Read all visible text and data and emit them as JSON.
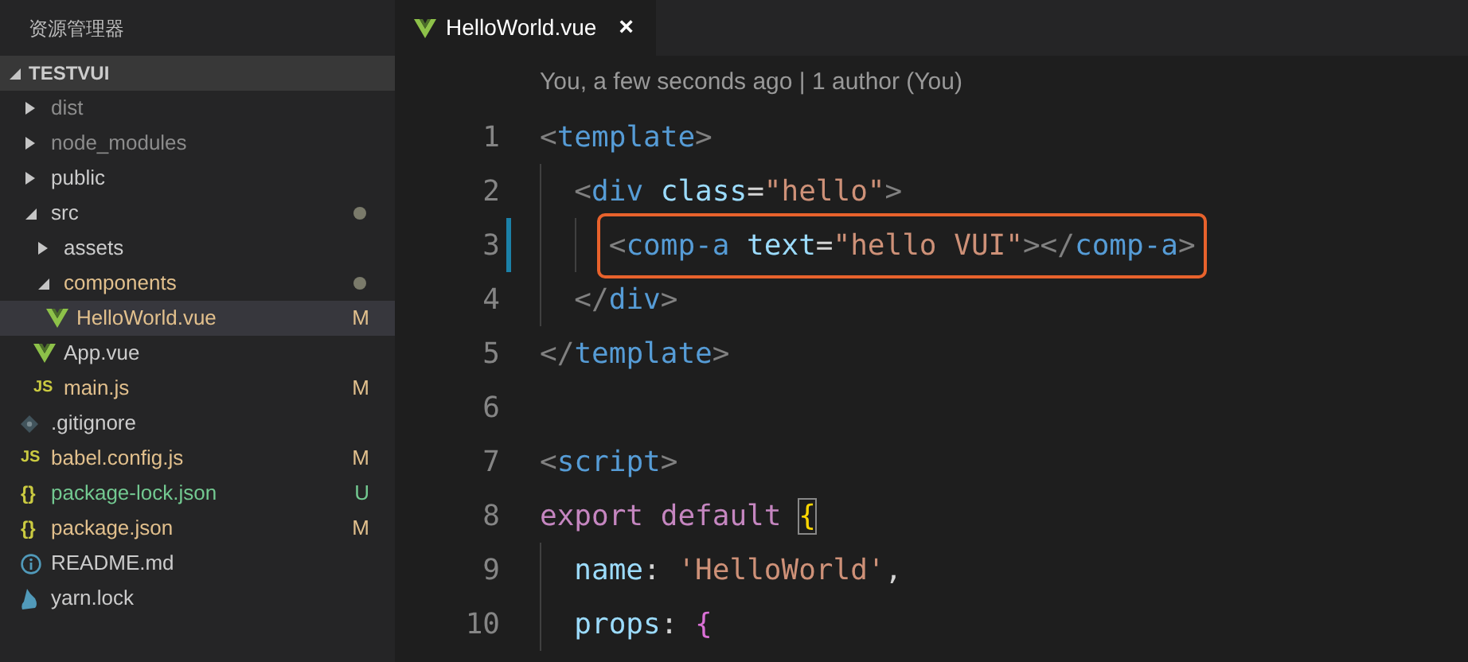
{
  "sidebar": {
    "title": "资源管理器",
    "root": {
      "name": "TESTVUI",
      "expanded": true,
      "children": [
        {
          "kind": "folder",
          "name": "dist",
          "expanded": false,
          "color": "#8c8c8c",
          "selected": false
        },
        {
          "kind": "folder",
          "name": "node_modules",
          "expanded": false,
          "color": "#8c8c8c",
          "selected": false
        },
        {
          "kind": "folder",
          "name": "public",
          "expanded": false,
          "color": "#cccccc",
          "selected": false
        },
        {
          "kind": "folder",
          "name": "src",
          "expanded": true,
          "color": "#cccccc",
          "has_changes": true,
          "selected": false,
          "children": [
            {
              "kind": "folder",
              "name": "assets",
              "expanded": false,
              "color": "#cccccc",
              "selected": false
            },
            {
              "kind": "folder",
              "name": "components",
              "expanded": true,
              "color": "#e2c08d",
              "has_changes": true,
              "selected": false,
              "children": [
                {
                  "kind": "vue",
                  "name": "HelloWorld.vue",
                  "color": "#e2c08d",
                  "badge": "M",
                  "selected": true
                }
              ]
            },
            {
              "kind": "vue",
              "name": "App.vue",
              "color": "#cccccc",
              "selected": false
            },
            {
              "kind": "js",
              "icon_text": "JS",
              "name": "main.js",
              "color": "#e2c08d",
              "badge": "M",
              "selected": false
            }
          ]
        },
        {
          "kind": "git",
          "name": ".gitignore",
          "color": "#cccccc",
          "selected": false
        },
        {
          "kind": "js",
          "icon_text": "JS",
          "name": "babel.config.js",
          "color": "#e2c08d",
          "badge": "M",
          "selected": false
        },
        {
          "kind": "json",
          "icon_text": "{}",
          "name": "package-lock.json",
          "color": "#73c991",
          "badge": "U",
          "selected": false
        },
        {
          "kind": "json",
          "icon_text": "{}",
          "name": "package.json",
          "color": "#e2c08d",
          "badge": "M",
          "selected": false
        },
        {
          "kind": "info",
          "name": "README.md",
          "color": "#cccccc",
          "selected": false
        },
        {
          "kind": "yarn",
          "name": "yarn.lock",
          "color": "#cccccc",
          "selected": false
        }
      ]
    }
  },
  "tabs": [
    {
      "kind": "vue",
      "label": "HelloWorld.vue",
      "close": "×",
      "selected": true
    }
  ],
  "codelens": "You, a few seconds ago | 1 author (You)",
  "lines": [
    {
      "number": "1",
      "tokens": [
        {
          "kind": "punct",
          "text": "<"
        },
        {
          "kind": "tag",
          "text": "template"
        },
        {
          "kind": "punct",
          "text": ">"
        }
      ]
    },
    {
      "number": "2",
      "tokens": [
        {
          "kind": "punct",
          "text": "  <"
        },
        {
          "kind": "tag",
          "text": "div"
        },
        {
          "kind": "attr",
          "text": " class"
        },
        {
          "kind": "op",
          "text": "="
        },
        {
          "kind": "string",
          "text": "\"hello\""
        },
        {
          "kind": "punct",
          "text": ">"
        }
      ]
    },
    {
      "number": "3",
      "changed": true,
      "boxed": true,
      "tokens": [
        {
          "kind": "punct",
          "text": "    <"
        },
        {
          "kind": "tag",
          "text": "comp-a"
        },
        {
          "kind": "attr",
          "text": " text"
        },
        {
          "kind": "op",
          "text": "="
        },
        {
          "kind": "string",
          "text": "\"hello VUI\""
        },
        {
          "kind": "punct",
          "text": "></"
        },
        {
          "kind": "tag",
          "text": "comp-a"
        },
        {
          "kind": "punct",
          "text": ">"
        }
      ]
    },
    {
      "number": "4",
      "tokens": [
        {
          "kind": "punct",
          "text": "  </"
        },
        {
          "kind": "tag",
          "text": "div"
        },
        {
          "kind": "punct",
          "text": ">"
        }
      ]
    },
    {
      "number": "5",
      "tokens": [
        {
          "kind": "punct",
          "text": "</"
        },
        {
          "kind": "tag",
          "text": "template"
        },
        {
          "kind": "punct",
          "text": ">"
        }
      ]
    },
    {
      "number": "6"
    },
    {
      "number": "7",
      "tokens": [
        {
          "kind": "punct",
          "text": "<"
        },
        {
          "kind": "tag",
          "text": "script"
        },
        {
          "kind": "punct",
          "text": ">"
        }
      ]
    },
    {
      "number": "8",
      "tokens": [
        {
          "kind": "keyword",
          "text": "export default "
        },
        {
          "kind": "bracket-match",
          "text": "{"
        }
      ]
    },
    {
      "number": "9",
      "tokens": [
        {
          "kind": "prop",
          "text": "  name"
        },
        {
          "kind": "op",
          "text": ": "
        },
        {
          "kind": "string",
          "text": "'HelloWorld'"
        },
        {
          "kind": "op",
          "text": ","
        }
      ]
    },
    {
      "number": "10",
      "tokens": [
        {
          "kind": "prop",
          "text": "  props"
        },
        {
          "kind": "op",
          "text": ": "
        },
        {
          "kind": "bracket2",
          "text": "{"
        }
      ]
    }
  ]
}
